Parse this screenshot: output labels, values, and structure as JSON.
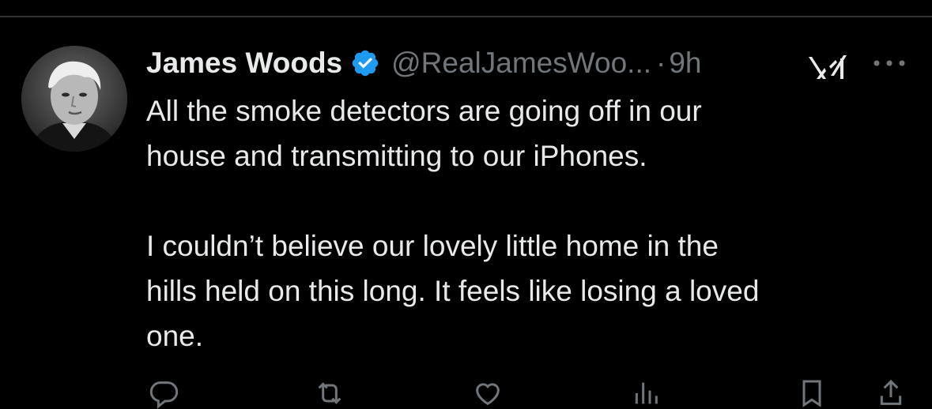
{
  "tweet": {
    "display_name": "James Woods",
    "handle": "@RealJamesWoo...",
    "separator": "·",
    "time": "9h",
    "text": "All the smoke detectors are going off in our\nhouse and transmitting to our iPhones.\n\nI couldn’t believe our lovely little home in the\nhills held on this long. It feels like losing a loved\none."
  },
  "icons": {
    "verified": "verified-badge-icon",
    "grok": "grok-icon",
    "more": "more-dots-icon",
    "reply": "reply-icon",
    "repost": "repost-icon",
    "like": "like-icon",
    "views": "views-icon",
    "bookmark": "bookmark-icon",
    "share": "share-icon"
  },
  "colors": {
    "background": "#000000",
    "text": "#e7e9ea",
    "secondary": "#71767b",
    "verified": "#1d9bf0",
    "divider": "#2f3336"
  }
}
